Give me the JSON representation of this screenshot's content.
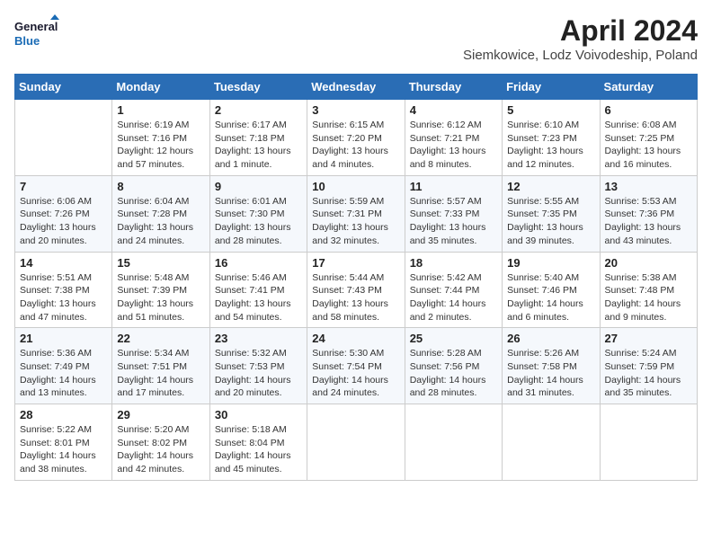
{
  "header": {
    "logo_line1": "General",
    "logo_line2": "Blue",
    "month_year": "April 2024",
    "location": "Siemkowice, Lodz Voivodeship, Poland"
  },
  "calendar": {
    "weekdays": [
      "Sunday",
      "Monday",
      "Tuesday",
      "Wednesday",
      "Thursday",
      "Friday",
      "Saturday"
    ],
    "weeks": [
      [
        {
          "day": "",
          "info": ""
        },
        {
          "day": "1",
          "info": "Sunrise: 6:19 AM\nSunset: 7:16 PM\nDaylight: 12 hours\nand 57 minutes."
        },
        {
          "day": "2",
          "info": "Sunrise: 6:17 AM\nSunset: 7:18 PM\nDaylight: 13 hours\nand 1 minute."
        },
        {
          "day": "3",
          "info": "Sunrise: 6:15 AM\nSunset: 7:20 PM\nDaylight: 13 hours\nand 4 minutes."
        },
        {
          "day": "4",
          "info": "Sunrise: 6:12 AM\nSunset: 7:21 PM\nDaylight: 13 hours\nand 8 minutes."
        },
        {
          "day": "5",
          "info": "Sunrise: 6:10 AM\nSunset: 7:23 PM\nDaylight: 13 hours\nand 12 minutes."
        },
        {
          "day": "6",
          "info": "Sunrise: 6:08 AM\nSunset: 7:25 PM\nDaylight: 13 hours\nand 16 minutes."
        }
      ],
      [
        {
          "day": "7",
          "info": "Sunrise: 6:06 AM\nSunset: 7:26 PM\nDaylight: 13 hours\nand 20 minutes."
        },
        {
          "day": "8",
          "info": "Sunrise: 6:04 AM\nSunset: 7:28 PM\nDaylight: 13 hours\nand 24 minutes."
        },
        {
          "day": "9",
          "info": "Sunrise: 6:01 AM\nSunset: 7:30 PM\nDaylight: 13 hours\nand 28 minutes."
        },
        {
          "day": "10",
          "info": "Sunrise: 5:59 AM\nSunset: 7:31 PM\nDaylight: 13 hours\nand 32 minutes."
        },
        {
          "day": "11",
          "info": "Sunrise: 5:57 AM\nSunset: 7:33 PM\nDaylight: 13 hours\nand 35 minutes."
        },
        {
          "day": "12",
          "info": "Sunrise: 5:55 AM\nSunset: 7:35 PM\nDaylight: 13 hours\nand 39 minutes."
        },
        {
          "day": "13",
          "info": "Sunrise: 5:53 AM\nSunset: 7:36 PM\nDaylight: 13 hours\nand 43 minutes."
        }
      ],
      [
        {
          "day": "14",
          "info": "Sunrise: 5:51 AM\nSunset: 7:38 PM\nDaylight: 13 hours\nand 47 minutes."
        },
        {
          "day": "15",
          "info": "Sunrise: 5:48 AM\nSunset: 7:39 PM\nDaylight: 13 hours\nand 51 minutes."
        },
        {
          "day": "16",
          "info": "Sunrise: 5:46 AM\nSunset: 7:41 PM\nDaylight: 13 hours\nand 54 minutes."
        },
        {
          "day": "17",
          "info": "Sunrise: 5:44 AM\nSunset: 7:43 PM\nDaylight: 13 hours\nand 58 minutes."
        },
        {
          "day": "18",
          "info": "Sunrise: 5:42 AM\nSunset: 7:44 PM\nDaylight: 14 hours\nand 2 minutes."
        },
        {
          "day": "19",
          "info": "Sunrise: 5:40 AM\nSunset: 7:46 PM\nDaylight: 14 hours\nand 6 minutes."
        },
        {
          "day": "20",
          "info": "Sunrise: 5:38 AM\nSunset: 7:48 PM\nDaylight: 14 hours\nand 9 minutes."
        }
      ],
      [
        {
          "day": "21",
          "info": "Sunrise: 5:36 AM\nSunset: 7:49 PM\nDaylight: 14 hours\nand 13 minutes."
        },
        {
          "day": "22",
          "info": "Sunrise: 5:34 AM\nSunset: 7:51 PM\nDaylight: 14 hours\nand 17 minutes."
        },
        {
          "day": "23",
          "info": "Sunrise: 5:32 AM\nSunset: 7:53 PM\nDaylight: 14 hours\nand 20 minutes."
        },
        {
          "day": "24",
          "info": "Sunrise: 5:30 AM\nSunset: 7:54 PM\nDaylight: 14 hours\nand 24 minutes."
        },
        {
          "day": "25",
          "info": "Sunrise: 5:28 AM\nSunset: 7:56 PM\nDaylight: 14 hours\nand 28 minutes."
        },
        {
          "day": "26",
          "info": "Sunrise: 5:26 AM\nSunset: 7:58 PM\nDaylight: 14 hours\nand 31 minutes."
        },
        {
          "day": "27",
          "info": "Sunrise: 5:24 AM\nSunset: 7:59 PM\nDaylight: 14 hours\nand 35 minutes."
        }
      ],
      [
        {
          "day": "28",
          "info": "Sunrise: 5:22 AM\nSunset: 8:01 PM\nDaylight: 14 hours\nand 38 minutes."
        },
        {
          "day": "29",
          "info": "Sunrise: 5:20 AM\nSunset: 8:02 PM\nDaylight: 14 hours\nand 42 minutes."
        },
        {
          "day": "30",
          "info": "Sunrise: 5:18 AM\nSunset: 8:04 PM\nDaylight: 14 hours\nand 45 minutes."
        },
        {
          "day": "",
          "info": ""
        },
        {
          "day": "",
          "info": ""
        },
        {
          "day": "",
          "info": ""
        },
        {
          "day": "",
          "info": ""
        }
      ]
    ]
  }
}
